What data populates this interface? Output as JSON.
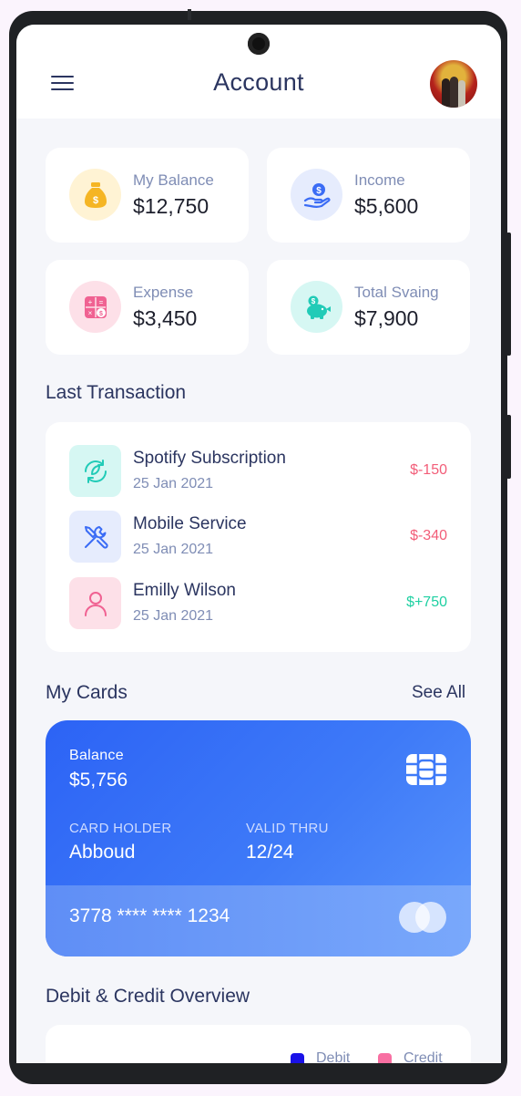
{
  "header": {
    "title": "Account"
  },
  "stats": [
    {
      "label": "My Balance",
      "value": "$12,750",
      "icon": "money-bag-icon",
      "bg": "#fff3d4",
      "color": "#f5b524"
    },
    {
      "label": "Income",
      "value": "$5,600",
      "icon": "hand-coin-icon",
      "bg": "#e6ecfd",
      "color": "#3b6cf5"
    },
    {
      "label": "Expense",
      "value": "$3,450",
      "icon": "calculator-icon",
      "bg": "#fde0e8",
      "color": "#f06292"
    },
    {
      "label": "Total Svaing",
      "value": "$7,900",
      "icon": "piggy-bank-icon",
      "bg": "#d6f7f3",
      "color": "#21cbb7"
    }
  ],
  "transactions": {
    "title": "Last Transaction",
    "items": [
      {
        "name": "Spotify Subscription",
        "date": "25 Jan 2021",
        "amount": "$-150",
        "icon": "refresh-subscription-icon",
        "amount_color": "#f25d78"
      },
      {
        "name": "Mobile Service",
        "date": "25 Jan 2021",
        "amount": "$-340",
        "icon": "tools-icon",
        "amount_color": "#f25d78"
      },
      {
        "name": "Emilly Wilson",
        "date": "25 Jan 2021",
        "amount": "$+750",
        "icon": "user-icon",
        "amount_color": "#1fd0a2"
      }
    ]
  },
  "cards": {
    "title": "My Cards",
    "see_all": "See All",
    "card": {
      "balance_label": "Balance",
      "balance": "$5,756",
      "holder_label": "CARD HOLDER",
      "holder": "Abboud",
      "valid_label": "VALID THRU",
      "valid": "12/24",
      "number": "3778 **** **** 1234"
    }
  },
  "overview": {
    "title": "Debit & Credit Overview",
    "legend": [
      {
        "label": "Debit",
        "color": "#1a12e8"
      },
      {
        "label": "Credit",
        "color": "#f86fa2"
      }
    ]
  }
}
